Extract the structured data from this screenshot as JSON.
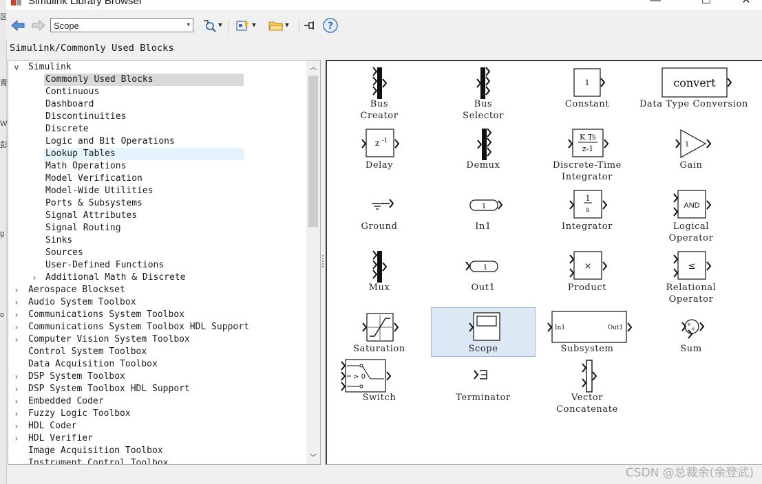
{
  "window": {
    "title": "Simulink Library Browser",
    "minimize": "—",
    "maximize": "☐",
    "close": "✕"
  },
  "toolbar": {
    "search_value": "Scope",
    "icons": [
      "back-icon",
      "forward-icon",
      "find-icon",
      "new-model-icon",
      "open-icon",
      "pin-icon",
      "help-icon"
    ]
  },
  "path": "Simulink/Commonly Used Blocks",
  "tree": [
    {
      "label": "Simulink",
      "level": 0,
      "chevron": "expanded"
    },
    {
      "label": "Commonly Used Blocks",
      "level": 1,
      "state": "selected"
    },
    {
      "label": "Continuous",
      "level": 1
    },
    {
      "label": "Dashboard",
      "level": 1
    },
    {
      "label": "Discontinuities",
      "level": 1
    },
    {
      "label": "Discrete",
      "level": 1
    },
    {
      "label": "Logic and Bit Operations",
      "level": 1
    },
    {
      "label": "Lookup Tables",
      "level": 1,
      "state": "hover"
    },
    {
      "label": "Math Operations",
      "level": 1
    },
    {
      "label": "Model Verification",
      "level": 1
    },
    {
      "label": "Model-Wide Utilities",
      "level": 1
    },
    {
      "label": "Ports & Subsystems",
      "level": 1
    },
    {
      "label": "Signal Attributes",
      "level": 1
    },
    {
      "label": "Signal Routing",
      "level": 1
    },
    {
      "label": "Sinks",
      "level": 1
    },
    {
      "label": "Sources",
      "level": 1
    },
    {
      "label": "User-Defined Functions",
      "level": 1
    },
    {
      "label": "Additional Math & Discrete",
      "level": 1,
      "chevron": "collapsed"
    },
    {
      "label": "Aerospace Blockset",
      "level": 0,
      "chevron": "collapsed"
    },
    {
      "label": "Audio System Toolbox",
      "level": 0,
      "chevron": "collapsed"
    },
    {
      "label": "Communications System Toolbox",
      "level": 0,
      "chevron": "collapsed"
    },
    {
      "label": "Communications System Toolbox HDL Support",
      "level": 0,
      "chevron": "collapsed"
    },
    {
      "label": "Computer Vision System Toolbox",
      "level": 0,
      "chevron": "collapsed"
    },
    {
      "label": "Control System Toolbox",
      "level": 0
    },
    {
      "label": "Data Acquisition Toolbox",
      "level": 0
    },
    {
      "label": "DSP System Toolbox",
      "level": 0,
      "chevron": "collapsed"
    },
    {
      "label": "DSP System Toolbox HDL Support",
      "level": 0,
      "chevron": "collapsed"
    },
    {
      "label": "Embedded Coder",
      "level": 0,
      "chevron": "collapsed"
    },
    {
      "label": "Fuzzy Logic Toolbox",
      "level": 0,
      "chevron": "collapsed"
    },
    {
      "label": "HDL Coder",
      "level": 0,
      "chevron": "collapsed"
    },
    {
      "label": "HDL Verifier",
      "level": 0,
      "chevron": "collapsed"
    },
    {
      "label": "Image Acquisition Toolbox",
      "level": 0
    },
    {
      "label": "Instrument Control Toolbox",
      "level": 0
    }
  ],
  "blocks": [
    {
      "key": "bus-creator",
      "label": [
        "Bus",
        "Creator"
      ]
    },
    {
      "key": "bus-selector",
      "label": [
        "Bus",
        "Selector"
      ]
    },
    {
      "key": "constant",
      "label": [
        "Constant"
      ],
      "icon_text": "1"
    },
    {
      "key": "data-type-conversion",
      "label": [
        "Data Type Conversion"
      ],
      "icon_text": "convert"
    },
    {
      "key": "delay",
      "label": [
        "Delay"
      ],
      "icon_text": "z",
      "icon_sup": "-1"
    },
    {
      "key": "demux",
      "label": [
        "Demux"
      ]
    },
    {
      "key": "discrete-time-integrator",
      "label": [
        "Discrete-Time",
        "Integrator"
      ],
      "icon_num": "K Ts",
      "icon_den": "z-1"
    },
    {
      "key": "gain",
      "label": [
        "Gain"
      ],
      "icon_text": "1"
    },
    {
      "key": "ground",
      "label": [
        "Ground"
      ]
    },
    {
      "key": "in1",
      "label": [
        "In1"
      ],
      "icon_text": "1"
    },
    {
      "key": "integrator",
      "label": [
        "Integrator"
      ],
      "icon_num": "1",
      "icon_den": "s"
    },
    {
      "key": "logical-operator",
      "label": [
        "Logical",
        "Operator"
      ],
      "icon_text": "AND"
    },
    {
      "key": "mux",
      "label": [
        "Mux"
      ]
    },
    {
      "key": "out1",
      "label": [
        "Out1"
      ],
      "icon_text": "1"
    },
    {
      "key": "product",
      "label": [
        "Product"
      ],
      "icon_text": "×"
    },
    {
      "key": "relational-operator",
      "label": [
        "Relational",
        "Operator"
      ],
      "icon_text": "≤"
    },
    {
      "key": "saturation",
      "label": [
        "Saturation"
      ]
    },
    {
      "key": "scope",
      "label": [
        "Scope"
      ],
      "state": "selected"
    },
    {
      "key": "subsystem",
      "label": [
        "Subsystem"
      ],
      "icon_in": "In1",
      "icon_out": "Out1"
    },
    {
      "key": "sum",
      "label": [
        "Sum"
      ]
    },
    {
      "key": "switch",
      "label": [
        "Switch"
      ],
      "icon_text": "> 0"
    },
    {
      "key": "terminator",
      "label": [
        "Terminator"
      ]
    },
    {
      "key": "vector-concatenate",
      "label": [
        "Vector",
        "Concatenate"
      ]
    }
  ],
  "watermark": "CSDN @总裁余(余登武)",
  "desktop_sliver": [
    "区",
    "青",
    "W",
    "彭",
    "g",
    "o"
  ]
}
